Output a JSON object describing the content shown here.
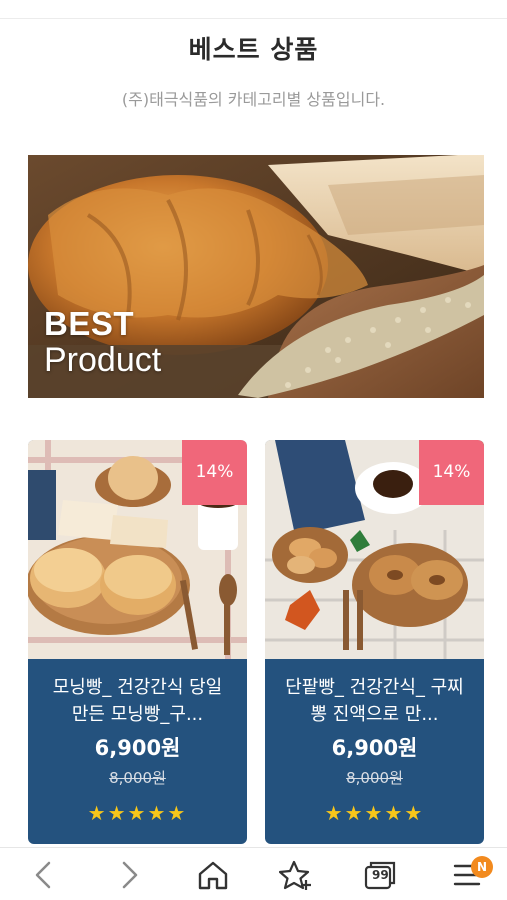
{
  "header": {
    "title": "베스트 상품",
    "subtitle": "(주)태극식품의 카테고리별 상품입니다."
  },
  "banner": {
    "line1": "BEST",
    "line2": "Product"
  },
  "products": [
    {
      "discount": "14%",
      "name": "모닝빵_ 건강간식 당일 만든 모닝빵_구...",
      "price": "6,900원",
      "original_price": "8,000원",
      "stars": "★★★★★",
      "rating": 5
    },
    {
      "discount": "14%",
      "name": "단팥빵_ 건강간식_ 구찌뽕 진액으로 만...",
      "price": "6,900원",
      "original_price": "8,000원",
      "stars": "★★★★★",
      "rating": 5
    }
  ],
  "bottom_nav": {
    "items": [
      "back-icon",
      "forward-icon",
      "home-icon",
      "star-plus-icon",
      "tabs-icon",
      "menu-icon"
    ],
    "tabs_label": "99",
    "badge": "N"
  },
  "colors": {
    "card_bg": "#24527e",
    "discount_bg": "#f0677a",
    "star": "#f7c61a",
    "badge": "#f28a1e"
  }
}
